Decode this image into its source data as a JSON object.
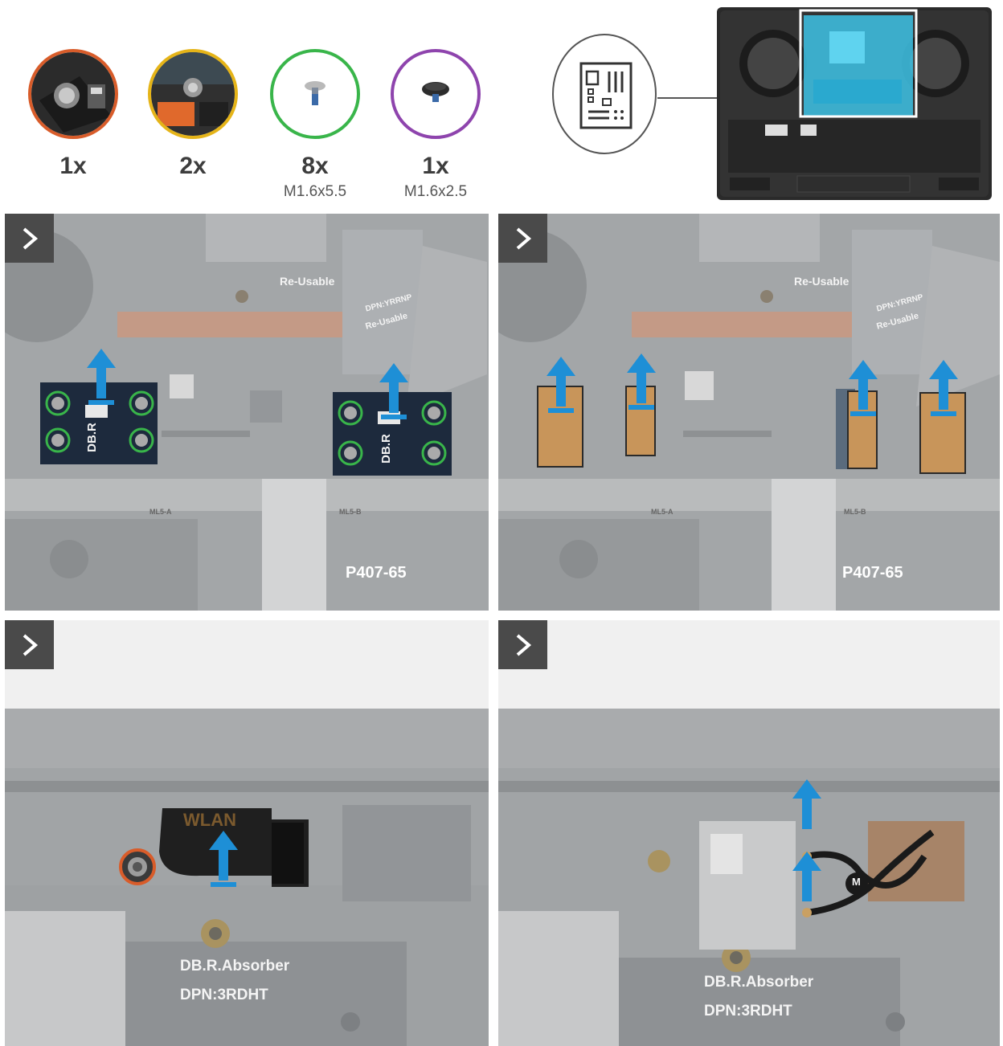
{
  "legend": [
    {
      "count": "1x",
      "size": "",
      "ring_color": "#d85c2a"
    },
    {
      "count": "2x",
      "size": "",
      "ring_color": "#e5b418"
    },
    {
      "count": "8x",
      "size": "M1.6x5.5",
      "ring_color": "#39b54a"
    },
    {
      "count": "1x",
      "size": "M1.6x2.5",
      "ring_color": "#8e44ad"
    }
  ],
  "overview": {
    "icon": "motherboard-icon"
  },
  "panels": {
    "p1": {
      "labels": [
        "Re-Usable",
        "DPN:YRRNP",
        "Re-Usable",
        "DB.R",
        "DB.R",
        "P407-65",
        "ML5-A",
        "ML5-B"
      ]
    },
    "p2": {
      "labels": [
        "Re-Usable",
        "DPN:YRRNP",
        "Re-Usable",
        "P407-65",
        "ML5-A",
        "ML5-B"
      ]
    },
    "p3": {
      "labels": [
        "WLAN",
        "DB.R.Absorber",
        "DPN:3RDHT"
      ]
    },
    "p4": {
      "labels": [
        "DB.R.Absorber",
        "DPN:3RDHT",
        "M"
      ]
    }
  },
  "colors": {
    "arrow": "#1e8fd6",
    "step_button": "#4a4a4a",
    "screw_ring_green": "#39b54a",
    "screw_ring_orange": "#d85c2a"
  }
}
